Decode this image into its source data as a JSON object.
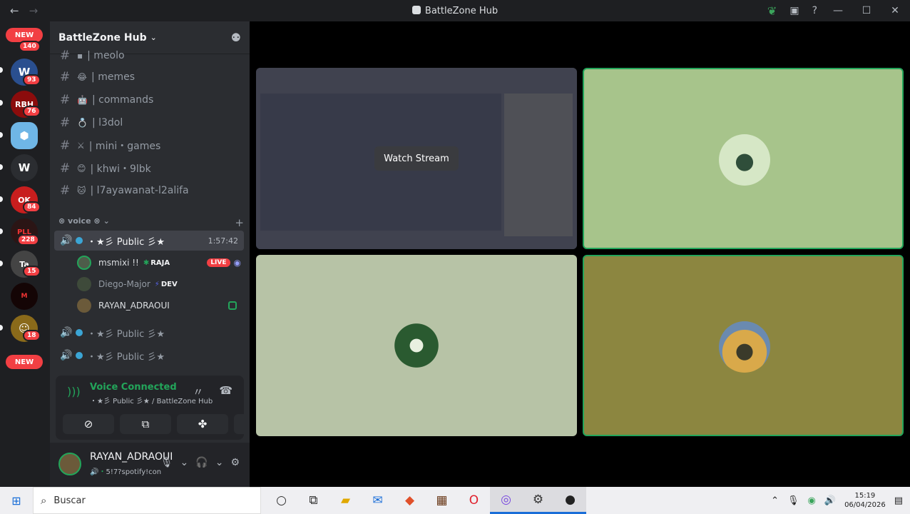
{
  "titlebar": {
    "back": "←",
    "forward": "→",
    "title": "BattleZone Hub",
    "minimize": "—",
    "maximize": "☐",
    "close": "✕",
    "help": "?"
  },
  "servers": {
    "new_top": "NEW",
    "new_bottom": "NEW",
    "badges": [
      "140",
      "93",
      "76",
      "84",
      "228",
      "15",
      "18"
    ]
  },
  "sidebar": {
    "server_name": "BattleZone Hub",
    "channels": [
      {
        "emoji": "▪",
        "name": "| meolo"
      },
      {
        "emoji": "😂",
        "name": "| memes"
      },
      {
        "emoji": "🤖",
        "name": "| commands"
      },
      {
        "emoji": "💍",
        "name": "| l3dol"
      },
      {
        "emoji": "⚔",
        "name": "| mini・games"
      },
      {
        "emoji": "😊",
        "name": "| khwi・9lbk"
      },
      {
        "emoji": "🐱",
        "name": "| l7ayawanat-l2alifa"
      }
    ],
    "voice_category": "⊗ voice ⊗",
    "voice_channels": [
      {
        "name": "・★彡 Public 彡★",
        "timer": "1:57:42"
      },
      {
        "name": "・★彡 Public 彡★",
        "timer": ""
      },
      {
        "name": "・★彡 Public 彡★",
        "timer": ""
      }
    ],
    "voice_users": [
      {
        "name": "msmixi !!",
        "tag": "RAJA",
        "live": "LIVE"
      },
      {
        "name": "Diego-Major",
        "tag": "DEV"
      },
      {
        "name": "RAYAN_ADRAOUI",
        "tag": ""
      }
    ]
  },
  "voice_panel": {
    "status": "Voice Connected",
    "channel": "・★彡 Public 彡★ / BattleZone Hub"
  },
  "user_panel": {
    "name": "RAYAN_ADRAOUI",
    "status": "5!7?spotify!con"
  },
  "stage": {
    "watch_label": "Watch Stream"
  },
  "taskbar": {
    "search_placeholder": "Buscar",
    "time": "15:19",
    "date": "06/04/2026"
  }
}
